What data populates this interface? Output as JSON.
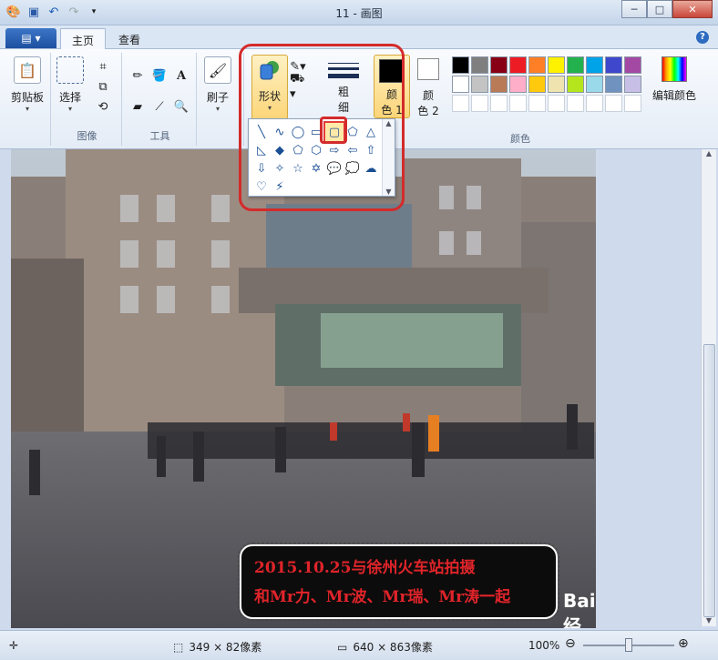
{
  "window": {
    "title": "11 - 画图",
    "minimize": "─",
    "maximize": "□",
    "close": "✕"
  },
  "tabs": {
    "home": "主页",
    "view": "查看",
    "help": "?"
  },
  "ribbon": {
    "clipboard_label": "剪贴板",
    "select_label": "选择",
    "image_group": "图像",
    "tools_group": "工具",
    "brush_label": "刷子",
    "shapes_label": "形状",
    "size_label": "粗\n细",
    "size_label_line1": "粗",
    "size_label_line2": "细",
    "color1_line1": "颜",
    "color1_line2": "色 1",
    "color2_line1": "颜",
    "color2_line2": "色 2",
    "edit_colors": "编辑颜色",
    "colors_group": "颜色"
  },
  "palette": [
    "#000000",
    "#7f7f7f",
    "#880015",
    "#ed1c24",
    "#ff7f27",
    "#fff200",
    "#22b14c",
    "#00a2e8",
    "#3f48cc",
    "#a349a4",
    "#ffffff",
    "#c3c3c3",
    "#b97a57",
    "#ffaec9",
    "#ffc90e",
    "#efe4b0",
    "#b5e61d",
    "#99d9ea",
    "#7092be",
    "#c8bfe7",
    "",
    "",
    "",
    "",
    "",
    "",
    "",
    "",
    "",
    ""
  ],
  "shapes": [
    "╲",
    "∿",
    "◯",
    "▭",
    "▢",
    "⬠",
    "△",
    "◺",
    "◆",
    "⬠",
    "⬡",
    "⇨",
    "⇦",
    "⇧",
    "⇩",
    "✧",
    "☆",
    "✡",
    "💬",
    "💭",
    "☁",
    "♡",
    "⚡"
  ],
  "selected_shape_index": 4,
  "caption": {
    "line1": "2015.10.25与徐州火车站拍摄",
    "line2": "和Mr力、Mr波、Mr瑞、Mr涛一起"
  },
  "watermark": "Bai 经验",
  "status": {
    "selection_size": "349 × 82像素",
    "image_size": "640 × 863像素",
    "zoom": "100%",
    "zoom_fraction": 0.5
  }
}
